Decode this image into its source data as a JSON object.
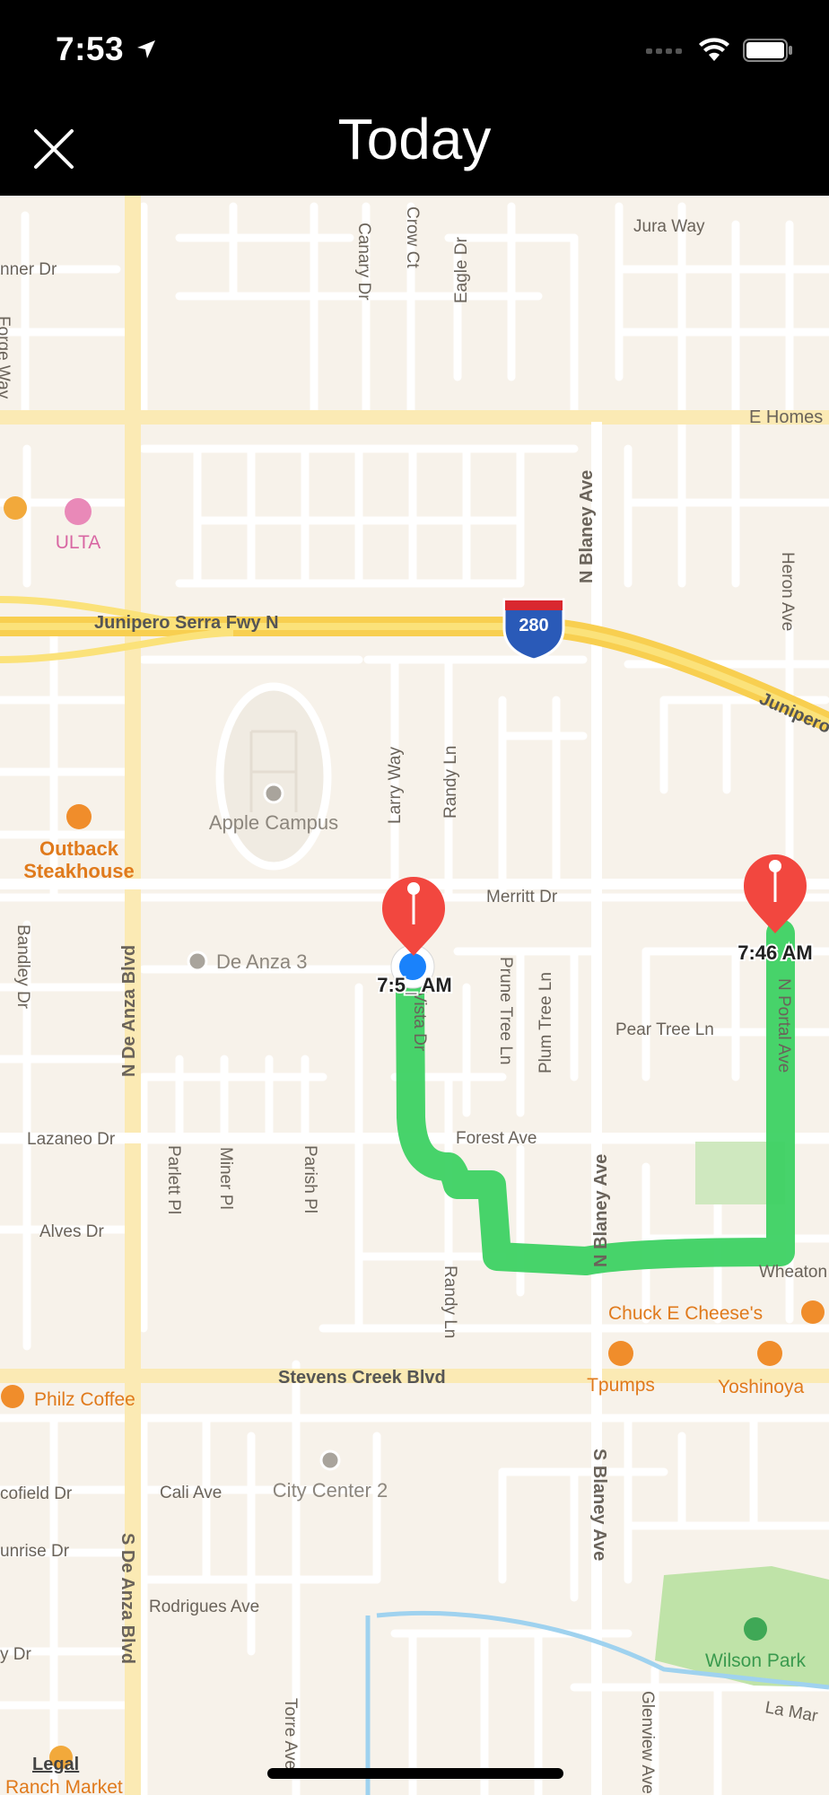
{
  "status_bar": {
    "time": "7:53",
    "icons": [
      "location-arrow-icon",
      "signal-icon",
      "wifi-icon",
      "battery-icon"
    ]
  },
  "header": {
    "title": "Today",
    "close_icon": "close-icon"
  },
  "map": {
    "route_color": "#3dd163",
    "pin_color": "#f2473f",
    "user_location_color": "#1a82fb",
    "pins": [
      {
        "label": "7:5_ AM",
        "kind": "start"
      },
      {
        "label": "7:46 AM",
        "kind": "end"
      }
    ],
    "street_labels": {
      "jura_way": "Jura Way",
      "crow_ct": "Crow Ct",
      "eagle_dr": "Eagle Dr",
      "canary_dr": "Canary Dr",
      "nner_dr": "nner Dr",
      "forge_way": "Forge Way",
      "e_homestead": "E Homes",
      "n_blaney_ave_top": "N Blaney Ave",
      "heron_ave": "Heron Ave",
      "junipero_serra": "Junipero Serra Fwy N",
      "junipero_right": "Junipero",
      "larry_way": "Larry Way",
      "randy_ln_top": "Randy Ln",
      "merritt_dr": "Merritt Dr",
      "bandley_dr": "Bandley Dr",
      "n_de_anza": "N De Anza Blvd",
      "vista_dr": "Vista Dr",
      "prune_tree": "Prune Tree Ln",
      "plum_tree": "Plum Tree Ln",
      "pear_tree": "Pear Tree Ln",
      "n_portal": "N Portal Ave",
      "lazaneo_dr": "Lazaneo Dr",
      "parlett_pl": "Parlett Pl",
      "miner_pl": "Miner Pl",
      "parish_pl": "Parish Pl",
      "forest_ave": "Forest Ave",
      "n_blaney_ave_mid": "N Blaney Ave",
      "alves_dr": "Alves Dr",
      "randy_ln_bottom": "Randy Ln",
      "wheaton": "Wheaton",
      "stevens_creek": "Stevens Creek Blvd",
      "s_blaney": "S Blaney Ave",
      "cofield_dr": "cofield Dr",
      "cali_ave": "Cali Ave",
      "s_de_anza": "S De Anza Blvd",
      "sunrise_dr": "unrise Dr",
      "rodrigues_ave": "Rodrigues Ave",
      "y_dr": "y Dr",
      "torre_ave": "Torre Ave",
      "glenview_ave": "Glenview Ave",
      "la_mar": "La Mar"
    },
    "interstate_shield": "280",
    "pois": {
      "ulta": "ULTA",
      "apple_campus": "Apple Campus",
      "outback_1": "Outback",
      "outback_2": "Steakhouse",
      "de_anza_3": "De Anza 3",
      "chuck_e_cheese": "Chuck E Cheese's",
      "tpumps": "Tpumps",
      "yoshinoya": "Yoshinoya",
      "philz": "Philz Coffee",
      "city_center_2": "City Center 2",
      "wilson_park": "Wilson Park",
      "ranch_market": "Ranch Market"
    },
    "legal": "Legal"
  }
}
